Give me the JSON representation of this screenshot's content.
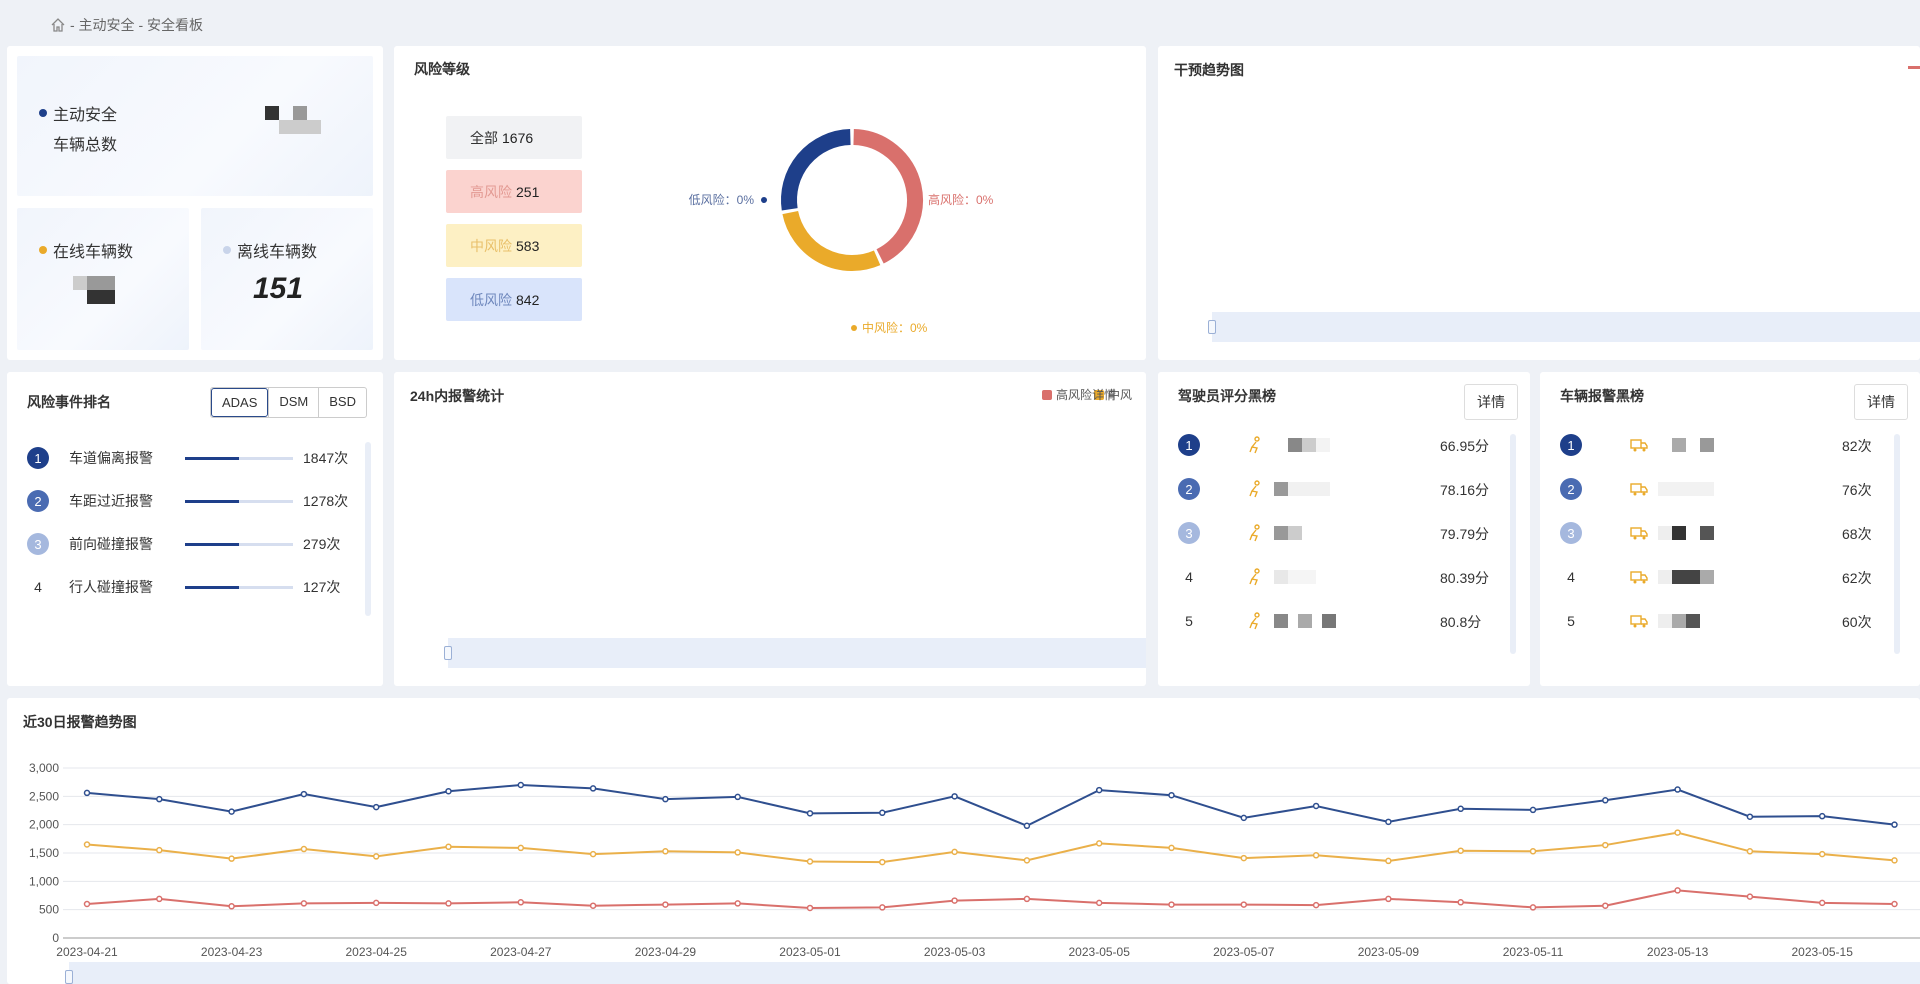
{
  "breadcrumb": {
    "home_icon": "home-icon",
    "path": "- 主动安全 - 安全看板"
  },
  "vehicle_stats": {
    "total_label_1": "主动安全",
    "total_label_2": "车辆总数",
    "online_label": "在线车辆数",
    "offline_label": "离线车辆数",
    "offline_value": "151",
    "colors": {
      "total": "#1e3f8a",
      "online": "#eaaa2a",
      "offline": "#c9d4ea"
    }
  },
  "risk_level": {
    "title": "风险等级",
    "pills": [
      {
        "label": "全部",
        "value": "1676",
        "bg": "#f1f2f4",
        "color": "#333"
      },
      {
        "label": "高风险",
        "value": "251",
        "bg": "#fbd3cf",
        "color": "#e39a93"
      },
      {
        "label": "中风险",
        "value": "583",
        "bg": "#fdf0c4",
        "color": "#e9c06a"
      },
      {
        "label": "低风险",
        "value": "842",
        "bg": "#d9e4fb",
        "color": "#6f88bd"
      }
    ],
    "donut": {
      "low_label": "低风险：0%",
      "high_label": "高风险：0%",
      "mid_label": "中风险：0%",
      "colors": {
        "low": "#1e3f8a",
        "high": "#d9706c",
        "mid": "#eaaa2a"
      }
    }
  },
  "intervention": {
    "title": "干预趋势图"
  },
  "ranking": {
    "title": "风险事件排名",
    "tabs": [
      "ADAS",
      "DSM",
      "BSD"
    ],
    "items": [
      {
        "rank": "1",
        "name": "车道偏离报警",
        "count": "1847次",
        "fill": 0.5,
        "badge": "#1e3f8a"
      },
      {
        "rank": "2",
        "name": "车距过近报警",
        "count": "1278次",
        "fill": 0.5,
        "badge": "#4a6bb2"
      },
      {
        "rank": "3",
        "name": "前向碰撞报警",
        "count": "279次",
        "fill": 0.5,
        "badge": "#a5b8de"
      },
      {
        "rank": "4",
        "name": "行人碰撞报警",
        "count": "127次",
        "fill": 0.5,
        "badge": ""
      }
    ]
  },
  "alarm24h": {
    "title": "24h内报警统计",
    "legend_high": "高风险",
    "legend_mid": "中风",
    "detail_overlap": "详情"
  },
  "driver_blacklist": {
    "title": "驾驶员评分黑榜",
    "detail": "详情",
    "rows": [
      {
        "rank": "1",
        "score": "66.95分"
      },
      {
        "rank": "2",
        "score": "78.16分"
      },
      {
        "rank": "3",
        "score": "79.79分"
      },
      {
        "rank": "4",
        "score": "80.39分"
      },
      {
        "rank": "5",
        "score": "80.8分"
      }
    ]
  },
  "vehicle_blacklist": {
    "title": "车辆报警黑榜",
    "detail": "详情",
    "rows": [
      {
        "rank": "1",
        "count": "82次"
      },
      {
        "rank": "2",
        "count": "76次"
      },
      {
        "rank": "3",
        "count": "68次"
      },
      {
        "rank": "4",
        "count": "62次"
      },
      {
        "rank": "5",
        "count": "60次"
      }
    ]
  },
  "trend30": {
    "title": "近30日报警趋势图"
  },
  "chart_data": {
    "type": "line",
    "title": "近30日报警趋势图",
    "x": [
      "2023-04-21",
      "2023-04-22",
      "2023-04-23",
      "2023-04-24",
      "2023-04-25",
      "2023-04-26",
      "2023-04-27",
      "2023-04-28",
      "2023-04-29",
      "2023-04-30",
      "2023-05-01",
      "2023-05-02",
      "2023-05-03",
      "2023-05-04",
      "2023-05-05",
      "2023-05-06",
      "2023-05-07",
      "2023-05-08",
      "2023-05-09",
      "2023-05-10",
      "2023-05-11",
      "2023-05-12",
      "2023-05-13",
      "2023-05-14",
      "2023-05-15",
      "2023-05-16"
    ],
    "xticks": [
      "2023-04-21",
      "2023-04-23",
      "2023-04-25",
      "2023-04-27",
      "2023-04-29",
      "2023-05-01",
      "2023-05-03",
      "2023-05-05",
      "2023-05-07",
      "2023-05-09",
      "2023-05-11",
      "2023-05-13",
      "2023-05-15"
    ],
    "yticks": [
      "0",
      "500",
      "1,000",
      "1,500",
      "2,000",
      "2,500",
      "3,000"
    ],
    "ylim": [
      0,
      3000
    ],
    "grid": true,
    "series": [
      {
        "color": "#2f4f8f",
        "values": [
          2560,
          2450,
          2230,
          2540,
          2310,
          2590,
          2700,
          2640,
          2450,
          2490,
          2200,
          2210,
          2500,
          1980,
          2610,
          2520,
          2120,
          2330,
          2050,
          2280,
          2260,
          2430,
          2620,
          2140,
          2150,
          2000
        ]
      },
      {
        "color": "#eab04a",
        "values": [
          1650,
          1550,
          1400,
          1570,
          1440,
          1610,
          1590,
          1480,
          1530,
          1510,
          1350,
          1340,
          1520,
          1370,
          1670,
          1590,
          1410,
          1460,
          1360,
          1540,
          1530,
          1640,
          1860,
          1530,
          1480,
          1370
        ]
      },
      {
        "color": "#d9706c",
        "values": [
          600,
          690,
          560,
          610,
          620,
          610,
          630,
          570,
          590,
          610,
          530,
          540,
          660,
          690,
          620,
          590,
          590,
          580,
          690,
          630,
          540,
          570,
          840,
          730,
          620,
          600
        ]
      }
    ]
  }
}
